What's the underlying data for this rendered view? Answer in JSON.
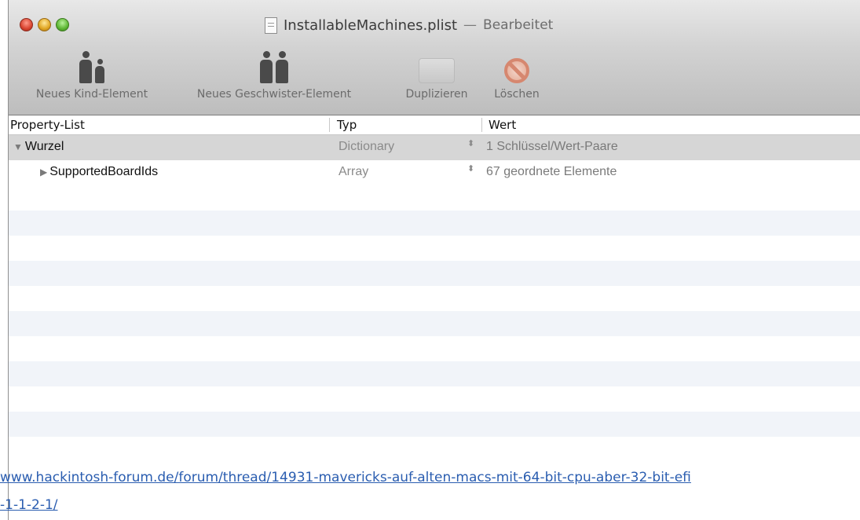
{
  "window": {
    "title": "InstallableMachines.plist",
    "separator": "—",
    "status": "Bearbeitet"
  },
  "toolbar": {
    "new_child_label": "Neues Kind-Element",
    "new_sibling_label": "Neues Geschwister-Element",
    "duplicate_label": "Duplizieren",
    "delete_label": "Löschen"
  },
  "table": {
    "columns": [
      "Property-List",
      "Typ",
      "Wert"
    ],
    "rows": [
      {
        "key": "Wurzel",
        "type": "Dictionary",
        "value": "1 Schlüssel/Wert-Paare",
        "expanded": true
      },
      {
        "key": "SupportedBoardIds",
        "type": "Array",
        "value": "67 geordnete Elemente",
        "expanded": false
      }
    ]
  },
  "overlay_link": {
    "line1": "www.hackintosh-forum.de/forum/thread/14931-mavericks-auf-alten-macs-mit-64-bit-cpu-aber-32-bit-efi",
    "line2": "-1-1-2-1/"
  },
  "icons": {
    "expanded_triangle": "▼",
    "collapsed_triangle": "▶",
    "stepper": "⬍"
  }
}
